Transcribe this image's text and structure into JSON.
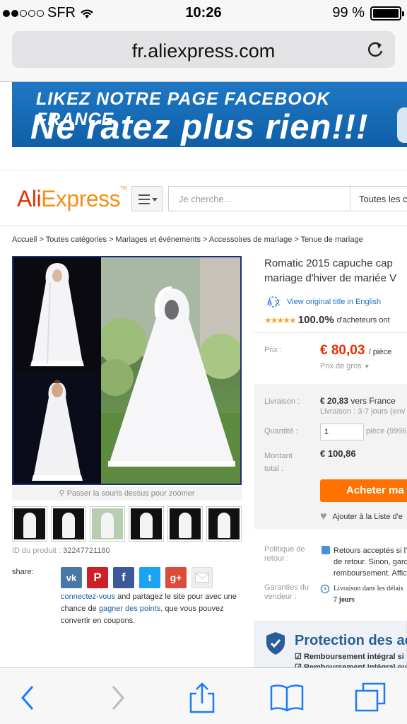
{
  "status_bar": {
    "carrier": "SFR",
    "time": "10:26",
    "battery": "99 %"
  },
  "browser": {
    "url": "fr.aliexpress.com"
  },
  "banner": {
    "line1": "LIKEZ NOTRE PAGE FACEBOOK FRANCE",
    "line2": "Ne ratez plus rien!!!"
  },
  "header": {
    "logo_part1": "Ali",
    "logo_part2": "Express",
    "logo_tm": "TM",
    "search_placeholder": "Je cherche...",
    "category": "Toutes les ca"
  },
  "breadcrumb": "Accueil > Toutes catégories > Mariages et événements > Accessoires de mariage > Tenue de mariage",
  "gallery": {
    "zoom_hint": "Passer la souris dessus pour zoomer",
    "thumbnail_count": 6
  },
  "product_id": {
    "label": "ID du produit :",
    "value": "32247721180"
  },
  "share": {
    "label": "share:",
    "icons": [
      "vk-icon",
      "pinterest-icon",
      "facebook-icon",
      "twitter-icon",
      "googleplus-icon",
      "email-icon"
    ],
    "link1": "connectez-vous",
    "text1": " and partagez le site pour avec une chance de ",
    "link2": "gagner des points",
    "text2": ", que vous pouvez convertir en coupons."
  },
  "product": {
    "title_line1": "Romatic 2015 capuche cap",
    "title_line2": "mariage d'hiver de mariée V",
    "view_original": "View original title in English",
    "rating_percent": "100.0%",
    "rating_text": "d'acheteurs ont",
    "stars": 5
  },
  "pricing": {
    "price_label": "Prix :",
    "price": "€ 80,03",
    "unit": "/ pièce",
    "wholesale": "Prix de gros"
  },
  "shipping": {
    "label": "Livraison :",
    "cost": "€ 20,83",
    "to": "vers",
    "country": "France",
    "time": "Livraison : 3-7 jours (env"
  },
  "quantity": {
    "label": "Quantité :",
    "value": "1",
    "stock": "pièce (9996"
  },
  "total": {
    "label1": "Montant",
    "label2": "total :",
    "value": "€ 100,86"
  },
  "actions": {
    "buy": "Acheter ma",
    "wishlist": "Ajouter à la Liste d'e"
  },
  "policy": {
    "label1": "Politique de",
    "label2": "retour :",
    "lines": [
      "Retours acceptés si l'",
      "de retour. Sinon, gard",
      "remboursement. Affic"
    ]
  },
  "guarantee": {
    "label1": "Garanties du",
    "label2": "vendeur :",
    "line1": "Livraison dans les délais",
    "line2": "7 jours"
  },
  "protection": {
    "title": "Protection des ac",
    "line1": "Remboursement intégral si",
    "line2": "Remboursement intégral ou"
  },
  "colors": {
    "brand_red": "#e62e04",
    "brand_orange": "#f39019",
    "buy_orange": "#ff7200",
    "link_blue": "#1f6fc6",
    "ios_blue": "#1a7cf5"
  }
}
